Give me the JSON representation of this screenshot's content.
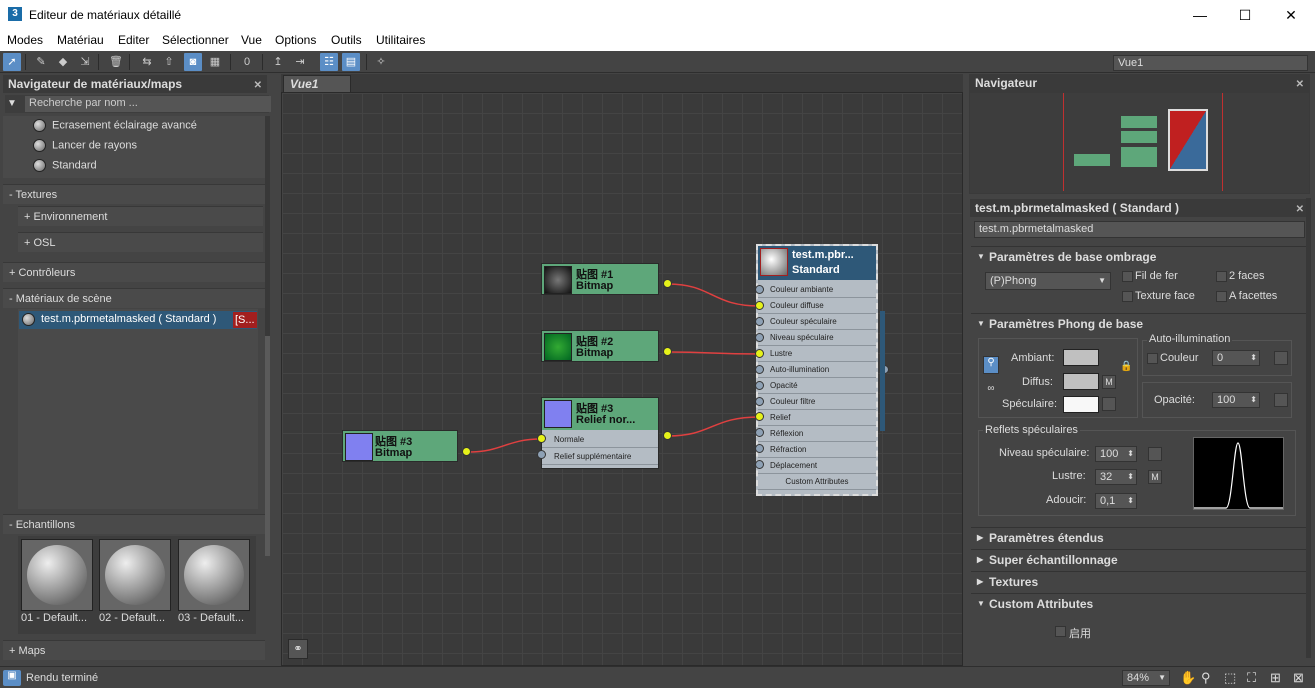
{
  "window": {
    "title": "Editeur de matériaux détaillé",
    "app_icon": "3",
    "minimize": "—",
    "maximize": "☐",
    "close": "✕"
  },
  "menu": [
    "Modes",
    "Matériau",
    "Editer",
    "Sélectionner",
    "Vue",
    "Options",
    "Outils",
    "Utilitaires"
  ],
  "toolbar": {
    "view_select": "Vue1"
  },
  "left_panel": {
    "title": "Navigateur de matériaux/maps",
    "search_placeholder": "Recherche par nom ...",
    "material_items": [
      "Ecrasement éclairage avancé",
      "Lancer de rayons",
      "Standard"
    ],
    "textures_header": "- Textures",
    "environment": "+ Environnement",
    "osl": "+ OSL",
    "controllers": "+ Contrôleurs",
    "scene_materials": "- Matériaux de scène",
    "scene_item": "test.m.pbrmetalmasked  ( Standard )",
    "scene_item_tag": "[S...",
    "samples_header": "- Echantillons",
    "samples": [
      "01 - Default...",
      "02 - Default...",
      "03 - Default..."
    ],
    "maps": "+ Maps"
  },
  "view_tab": "Vue1",
  "nodes": {
    "map1": {
      "title": "贴图 #1",
      "type": "Bitmap"
    },
    "map2": {
      "title": "贴图 #2",
      "type": "Bitmap"
    },
    "map3a": {
      "title": "贴图 #3",
      "type": "Bitmap"
    },
    "map3b": {
      "title": "贴图 #3",
      "type": "Relief nor...",
      "slots": [
        "Normale",
        "Relief supplémentaire"
      ]
    },
    "material": {
      "title": "test.m.pbr...",
      "type": "Standard",
      "slots": [
        "Couleur ambiante",
        "Couleur diffuse",
        "Couleur spéculaire",
        "Niveau spéculaire",
        "Lustre",
        "Auto-illumination",
        "Opacité",
        "Couleur filtre",
        "Relief",
        "Réflexion",
        "Réfraction",
        "Déplacement",
        "Custom Attributes"
      ]
    }
  },
  "navigator": {
    "title": "Navigateur"
  },
  "params": {
    "title": "test.m.pbrmetalmasked  ( Standard )",
    "name_field": "test.m.pbrmetalmasked",
    "shading_section": "Paramètres de base ombrage",
    "shading_dropdown": "(P)Phong",
    "wire": "Fil de fer",
    "two_sided": "2 faces",
    "face_map": "Texture face",
    "faceted": "A facettes",
    "phong_section": "Paramètres Phong de base",
    "self_illum_group": "Auto-illumination",
    "ambient": "Ambiant:",
    "diffuse": "Diffus:",
    "specular": "Spéculaire:",
    "color_chk": "Couleur",
    "self_illum_value": "0",
    "opacity_label": "Opacité:",
    "opacity_value": "100",
    "m_label": "M",
    "spec_group": "Reflets spéculaires",
    "spec_level_label": "Niveau spéculaire:",
    "spec_level": "100",
    "gloss_label": "Lustre:",
    "gloss": "32",
    "soften_label": "Adoucir:",
    "soften": "0,1",
    "extended": "Paramètres étendus",
    "supersampling": "Super échantillonnage",
    "textures": "Textures",
    "custom_attributes": "Custom Attributes",
    "enable": "启用"
  },
  "status": {
    "text": "Rendu terminé",
    "zoom": "84%"
  },
  "colors": {
    "node_green": "#5ea77a",
    "material_head": "#2e5878",
    "accent": "#5b8ec6",
    "port_yellow": "#e6f21a",
    "wire_red": "#e04040"
  }
}
